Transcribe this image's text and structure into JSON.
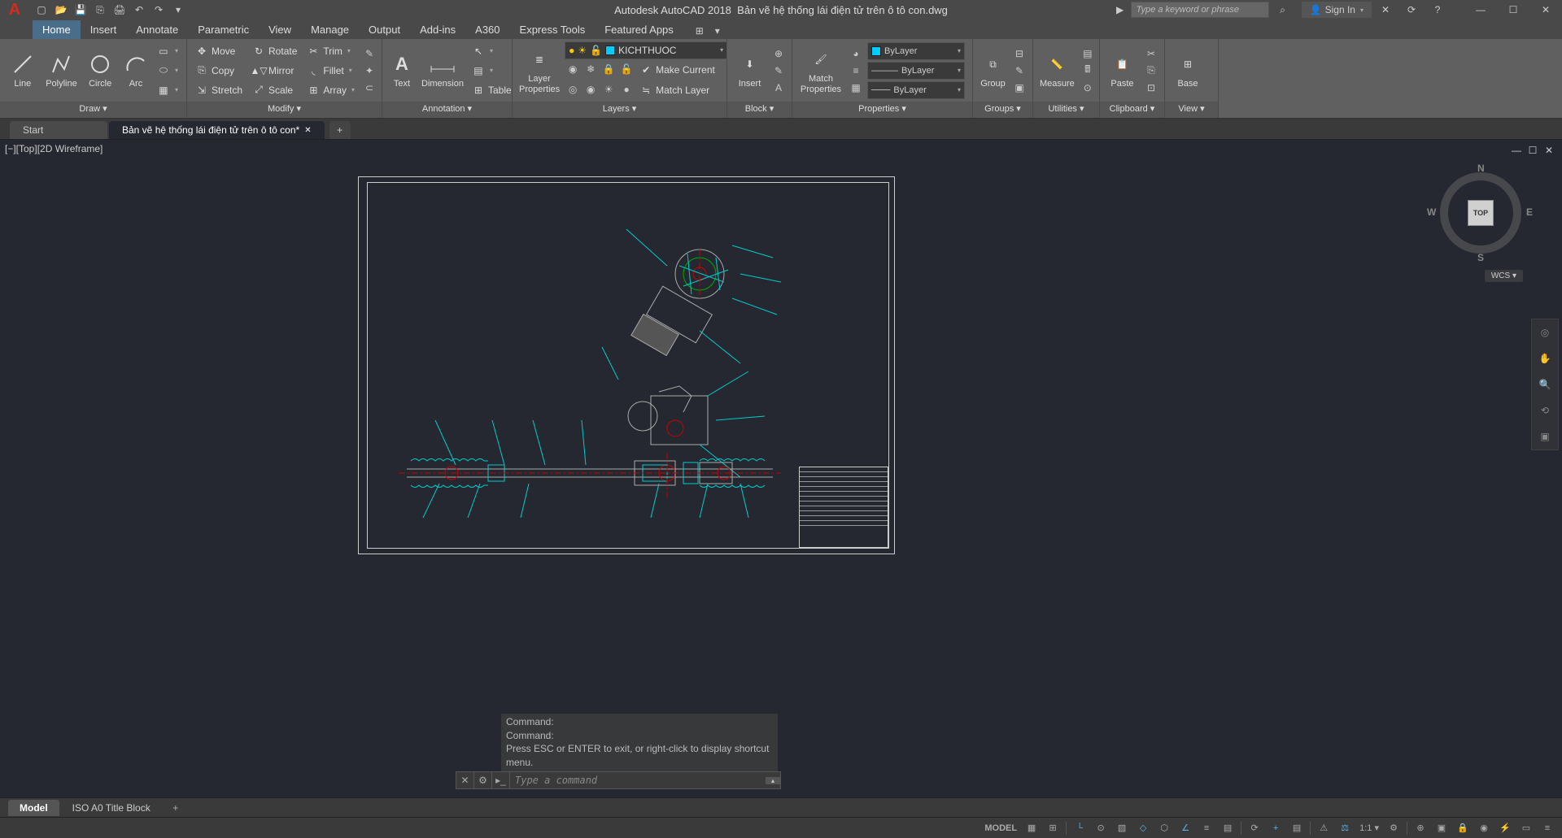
{
  "app": {
    "title_app": "Autodesk AutoCAD 2018",
    "title_file": "Bản vẽ hệ thống lái điện tử trên ô tô con.dwg",
    "search_placeholder": "Type a keyword or phrase",
    "signin": "Sign In"
  },
  "menu": {
    "tabs": [
      "Home",
      "Insert",
      "Annotate",
      "Parametric",
      "View",
      "Manage",
      "Output",
      "Add-ins",
      "A360",
      "Express Tools",
      "Featured Apps"
    ],
    "active": "Home"
  },
  "ribbon": {
    "draw": {
      "label": "Draw ▾",
      "line": "Line",
      "polyline": "Polyline",
      "circle": "Circle",
      "arc": "Arc"
    },
    "modify": {
      "label": "Modify ▾",
      "move": "Move",
      "copy": "Copy",
      "stretch": "Stretch",
      "rotate": "Rotate",
      "mirror": "Mirror",
      "scale": "Scale",
      "trim": "Trim",
      "fillet": "Fillet",
      "array": "Array"
    },
    "annotation": {
      "label": "Annotation ▾",
      "text": "Text",
      "dimension": "Dimension",
      "table": "Table"
    },
    "layers": {
      "label": "Layers ▾",
      "props": "Layer\nProperties",
      "current": "KICHTHUOC",
      "makecurrent": "Make Current",
      "matchlayer": "Match Layer"
    },
    "block": {
      "label": "Block ▾",
      "insert": "Insert"
    },
    "properties": {
      "label": "Properties ▾",
      "match": "Match\nProperties",
      "bylayer": "ByLayer"
    },
    "groups": {
      "label": "Groups ▾",
      "group": "Group"
    },
    "utilities": {
      "label": "Utilities ▾",
      "measure": "Measure"
    },
    "clipboard": {
      "label": "Clipboard ▾",
      "paste": "Paste"
    },
    "view": {
      "label": "View ▾",
      "base": "Base"
    }
  },
  "filetabs": {
    "start": "Start",
    "active": "Bản vẽ hệ thống lái điện tử trên ô tô con*"
  },
  "viewport": {
    "label": "[−][Top][2D Wireframe]"
  },
  "viewcube": {
    "face": "TOP",
    "n": "N",
    "s": "S",
    "e": "E",
    "w": "W",
    "wcs": "WCS ▾"
  },
  "cmd": {
    "h1": "Command:",
    "h2": "Command:",
    "h3": "Press ESC or ENTER to exit, or right-click to display shortcut menu.",
    "placeholder": "Type a command"
  },
  "layouts": {
    "model": "Model",
    "iso": "ISO A0 Title Block"
  },
  "status": {
    "model": "MODEL",
    "scale": "1:1"
  }
}
